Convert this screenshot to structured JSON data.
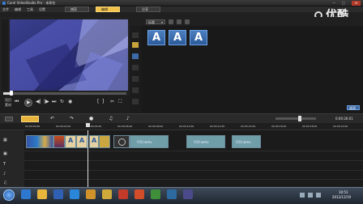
{
  "app": {
    "title": "Corel VideoStudio Pro - 未命名",
    "window_controls": [
      "—",
      "□",
      "✕"
    ]
  },
  "menu": {
    "items": [
      "文件",
      "编辑",
      "工具",
      "设置"
    ]
  },
  "steps": {
    "items": [
      "捕获",
      "编辑",
      "分享"
    ],
    "active": "编辑"
  },
  "watermark": "优酷",
  "preview": {
    "mode_labels": [
      "项目",
      "素材"
    ],
    "timecode": "0:00:00:00",
    "progress": 0.05
  },
  "library": {
    "gallery_dropdown": "标题",
    "tiles": [
      {
        "letter": "A",
        "caption": ""
      },
      {
        "letter": "A",
        "caption": ""
      },
      {
        "letter": "A",
        "caption": ""
      }
    ],
    "options_button": "选项"
  },
  "timeline": {
    "timecode": "0:00:26:01",
    "ruler_ticks": [
      "00:00:00:00",
      "00:00:02:00",
      "00:00:04:00",
      "00:00:06:00",
      "00:00:08:00",
      "00:00:10:00",
      "00:00:12:00",
      "00:00:14:00",
      "00:00:16:00",
      "00:00:18:00",
      "00:00:20:00"
    ],
    "clips": [
      {
        "label": "V10.wmv"
      },
      {
        "label": "V10.wmv"
      },
      {
        "label": "V10.wmv"
      }
    ]
  },
  "taskbar": {
    "clock_time": "10:51",
    "clock_date": "2012/12/19"
  }
}
